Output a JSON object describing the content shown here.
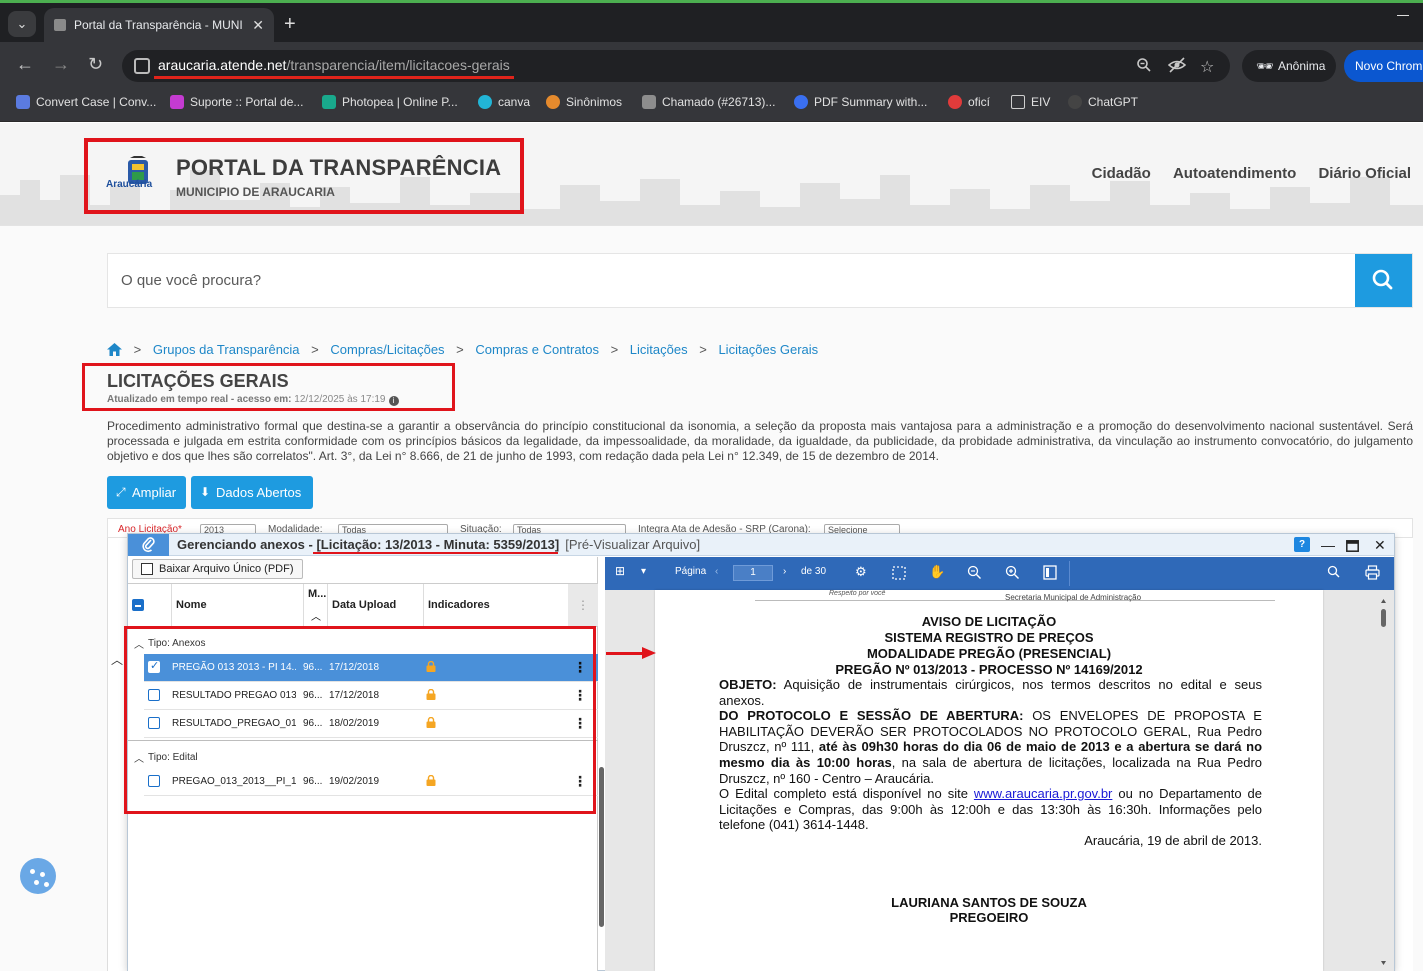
{
  "browser": {
    "tab_title": "Portal da Transparência - MUNI",
    "url_host": "araucaria.atende.net",
    "url_path": "/transparencia/item/licitacoes-gerais",
    "incognito_label": "Anônima",
    "new_chrome_label": "Novo Chrom",
    "bookmarks": [
      {
        "label": "Convert Case | Conv...",
        "color": "#5b7be0"
      },
      {
        "label": "Suporte :: Portal de...",
        "color": "#c43bd1"
      },
      {
        "label": "Photopea | Online P...",
        "color": "#19a98c"
      },
      {
        "label": "canva",
        "color": "#22b5d6"
      },
      {
        "label": "Sinônimos",
        "color": "#e58a2d"
      },
      {
        "label": "Chamado (#26713)...",
        "color": "#8d8d8d"
      },
      {
        "label": "PDF Summary with...",
        "color": "#3a6ff0"
      },
      {
        "label": "oficí",
        "color": "#e03b3b"
      },
      {
        "label": "EIV",
        "color": "#cfcfcf"
      },
      {
        "label": "ChatGPT",
        "color": "#444444"
      }
    ]
  },
  "header": {
    "logo_text": "Araucária",
    "title": "PORTAL DA TRANSPARÊNCIA",
    "subtitle": "MUNICIPIO DE ARAUCARIA",
    "nav": [
      "Cidadão",
      "Autoatendimento",
      "Diário Oficial"
    ]
  },
  "search": {
    "placeholder": "O que você procura?"
  },
  "breadcrumb": [
    "Grupos da Transparência",
    "Compras/Licitações",
    "Compras e Contratos",
    "Licitações",
    "Licitações Gerais"
  ],
  "page": {
    "title": "LICITAÇÕES GERAIS",
    "updated_label": "Atualizado em tempo real - acesso em:",
    "updated_value": "12/12/2025 às 17:19",
    "description": "Procedimento administrativo formal que destina-se a garantir a observância do princípio constitucional da isonomia, a seleção da proposta mais vantajosa para a administração e a promoção do desenvolvimento nacional sustentável. Será processada e julgada em estrita conformidade com os princípios básicos da legalidade, da impessoalidade, da moralidade, da igualdade, da publicidade, da probidade administrativa, da vinculação ao instrumento convocatório, do julgamento objetivo e dos que lhes são correlatos\". Art. 3°, da Lei n° 8.666, de 21 de junho de 1993, com redação dada pela Lei n° 12.349, de 15 de dezembro de 2014.",
    "btn_ampliar": "Ampliar",
    "btn_dados": "Dados Abertos"
  },
  "filters": {
    "ano_label": "Ano Licitação*",
    "ano_value": "2013",
    "modalidade_label": "Modalidade:",
    "modalidade_value": "Todas",
    "situacao_label": "Situação:",
    "situacao_value": "Todas",
    "ata_label": "Integra Ata de Adesão - SRP (Carona):",
    "ata_value": "Selecione"
  },
  "dialog": {
    "title": "Gerenciando anexos - ",
    "title_highlight": "[Licitação: 13/2013 - Minuta: 5359/2013]",
    "subtitle": "[Pré-Visualizar Arquivo]",
    "help": "?",
    "download_button": "Baixar Arquivo Único (PDF)",
    "columns": [
      "Nome",
      "M...",
      "Data Upload",
      "Indicadores"
    ],
    "groups": [
      {
        "label": "Tipo: Anexos",
        "rows": [
          {
            "name": "PREGÃO 013 2013 - PI 14...",
            "m": "96...",
            "date": "17/12/2018",
            "selected": true
          },
          {
            "name": "RESULTADO PREGAO 013...",
            "m": "96...",
            "date": "17/12/2018",
            "selected": false
          },
          {
            "name": "RESULTADO_PREGAO_01...",
            "m": "96...",
            "date": "18/02/2019",
            "selected": false
          }
        ]
      },
      {
        "label": "Tipo: Edital",
        "rows": [
          {
            "name": "PREGAO_013_2013__PI_1...",
            "m": "96...",
            "date": "19/02/2019",
            "selected": false
          }
        ]
      }
    ],
    "lock_color": "#f5a623",
    "accent_color": "#4a90d9"
  },
  "pdf": {
    "page_label": "Página",
    "page_value": "1",
    "page_total": "de 30",
    "letterhead_left": "Respeito por você",
    "letterhead_right": "Secretaria Municipal de Administração",
    "headings": [
      "AVISO DE LICITAÇÃO",
      "SISTEMA REGISTRO DE PREÇOS",
      "MODALIDADE PREGÃO (PRESENCIAL)",
      "PREGÃO Nº 013/2013 - PROCESSO Nº 14169/2012"
    ],
    "objeto_label": "OBJETO:",
    "objeto_text": " Aquisição de instrumentais cirúrgicos, nos termos descritos no edital e seus anexos.",
    "protocolo_label": "DO PROTOCOLO E SESSÃO DE ABERTURA:",
    "protocolo_text1": " OS ENVELOPES DE PROPOSTA E HABILITAÇÃO DEVERÃO SER PROTOCOLADOS NO PROTOCOLO GERAL, Rua Pedro Druszcz, nº 111, ",
    "protocolo_bold": "até às 09h30 horas do dia 06 de maio de 2013 e a abertura se dará no mesmo dia às 10:00 horas",
    "protocolo_text2": ", na sala de abertura de licitações, localizada na Rua Pedro Druszcz, nº 160 - Centro – Araucária.",
    "edital_text1": "O Edital completo está disponível no site ",
    "edital_link": "www.araucaria.pr.gov.br",
    "edital_text2": " ou no Departamento de Licitações e Compras, das 9:00h às 12:00h e das 13:30h às 16:30h. Informações pelo telefone (041) 3614-1448.",
    "date": "Araucária, 19 de abril de 2013.",
    "signer_name": "LAURIANA SANTOS DE SOUZA",
    "signer_role": "PREGOEIRO"
  }
}
